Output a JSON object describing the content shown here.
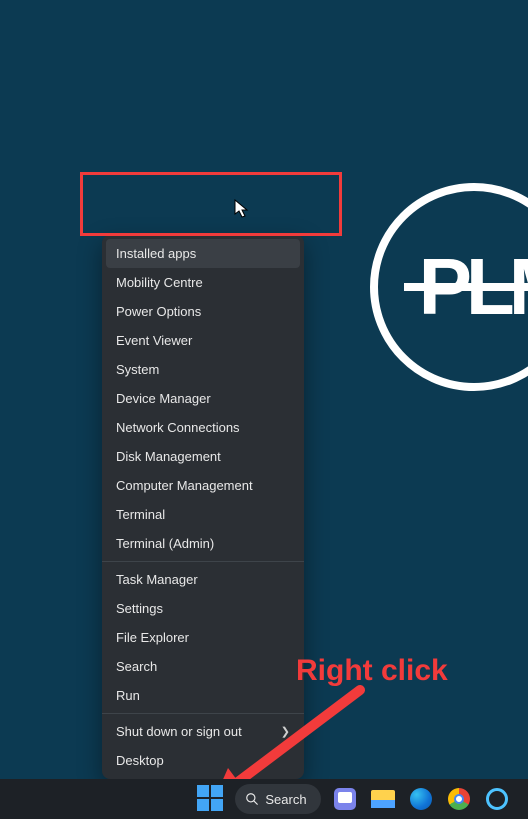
{
  "annotation": {
    "text": "Right click"
  },
  "logo_text": "PLM",
  "taskbar": {
    "search_label": "Search"
  },
  "context_menu": {
    "group1": [
      "Installed apps",
      "Mobility Centre",
      "Power Options",
      "Event Viewer",
      "System",
      "Device Manager",
      "Network Connections",
      "Disk Management",
      "Computer Management",
      "Terminal",
      "Terminal (Admin)"
    ],
    "group2": [
      "Task Manager",
      "Settings",
      "File Explorer",
      "Search",
      "Run"
    ],
    "group3": [
      {
        "label": "Shut down or sign out",
        "submenu": true
      },
      {
        "label": "Desktop",
        "submenu": false
      }
    ]
  }
}
